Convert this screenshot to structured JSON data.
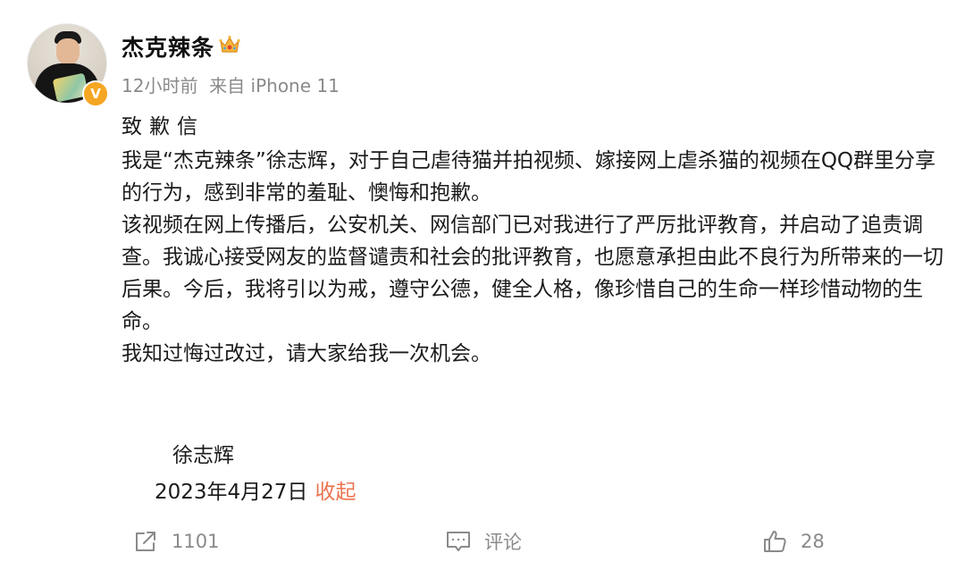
{
  "post": {
    "username": "杰克辣条",
    "meta": "12小时前  来自 iPhone 11",
    "title": "致歉信",
    "paragraphs": [
      "我是“杰克辣条”徐志辉，对于自己虐待猫并拍视频、嫁接网上虐杀猫的视频在QQ群里分享的行为，感到非常的羞耻、懊悔和抱歉。",
      "该视频在网上传播后，公安机关、网信部门已对我进行了严厉批评教育，并启动了追责调查。我诚心接受网友的监督谴责和社会的批评教育，也愿意承担由此不良行为所带来的一切后果。今后，我将引以为戒，遵守公德，健全人格，像珍惜自己的生命一样珍惜动物的生命。",
      "我知过悔过改过，请大家给我一次机会。"
    ],
    "signature": "徐志辉",
    "date": "2023年4月27日",
    "collapse_label": "收起"
  },
  "badges": {
    "verified_label": "V",
    "verified_color": "#f5a623",
    "crown_icon": "crown-icon"
  },
  "actions": {
    "repost_count": "1101",
    "comment_label": "评论",
    "like_count": "28"
  },
  "colors": {
    "link": "#eb7350",
    "muted": "#8a8a8a",
    "text": "#1b1b1b"
  }
}
